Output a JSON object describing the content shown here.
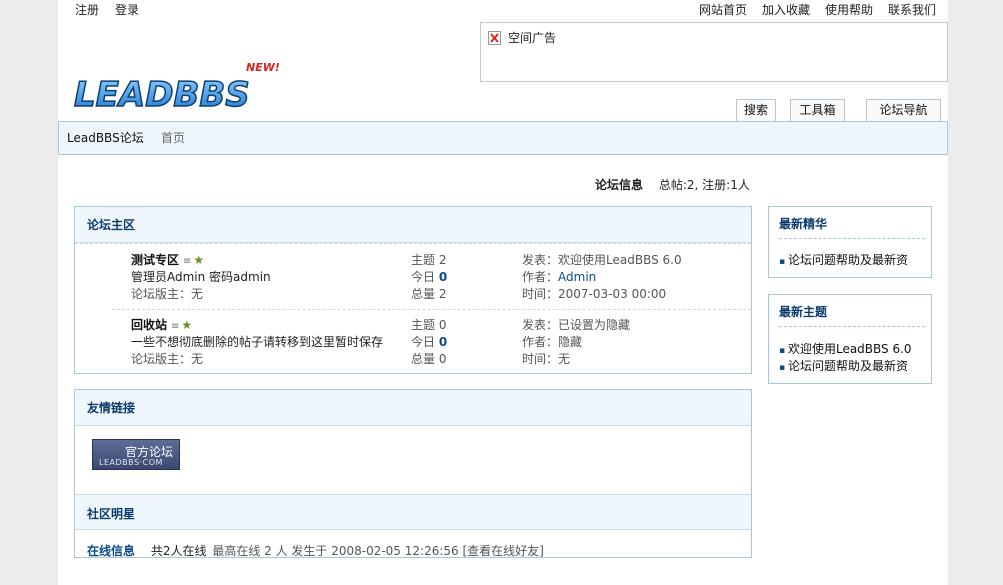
{
  "top_left": {
    "register": "注册",
    "login": "登录"
  },
  "top_right": [
    "网站首页",
    "加入收藏",
    "使用帮助",
    "联系我们"
  ],
  "ad": {
    "label": "空间广告"
  },
  "logo": {
    "text": "LEADBBS",
    "badge": "NEW!"
  },
  "tabs": [
    "搜索",
    "工具箱",
    "论坛导航"
  ],
  "breadcrumb": {
    "forum": "LeadBBS论坛",
    "home": "首页"
  },
  "forum_info": {
    "label": "论坛信息",
    "stats": "总帖:2, 注册:1人"
  },
  "main_section": {
    "title": "论坛主区",
    "forums": [
      {
        "name": "测试专区",
        "desc": "管理员Admin 密码admin",
        "moderator": "论坛版主：无",
        "topics_label": "主题",
        "topics": "2",
        "today_label": "今日",
        "today": "0",
        "total_label": "总量",
        "total": "2",
        "post_label": "发表：",
        "post": "欢迎使用LeadBBS 6.0",
        "author_label": "作者：",
        "author": "Admin",
        "time_label": "时间：",
        "time": "2007-03-03 00:00"
      },
      {
        "name": "回收站",
        "desc": "一些不想彻底删除的帖子请转移到这里暂时保存",
        "moderator": "论坛版主：无",
        "topics_label": "主题",
        "topics": "0",
        "today_label": "今日",
        "today": "0",
        "total_label": "总量",
        "total": "0",
        "post_label": "发表：",
        "post": "已设置为隐藏",
        "author_label": "作者：",
        "author": "隐藏",
        "time_label": "时间：",
        "time": "无"
      }
    ]
  },
  "links_section": {
    "title": "友情链接",
    "badge_main": "官方论坛",
    "badge_sub": "LEADBBS·COM"
  },
  "stars_section": {
    "title": "社区明星"
  },
  "online": {
    "title": "在线信息",
    "prefix": "共2人在线",
    "max": "最高在线 2 人 发生于 2008-02-05 12:26:56",
    "link_open": "[",
    "link": "查看在线好友",
    "link_close": "]"
  },
  "sidebar": {
    "featured": {
      "title": "最新精华",
      "items": [
        "论坛问题帮助及最新资"
      ]
    },
    "latest": {
      "title": "最新主题",
      "items": [
        "欢迎使用LeadBBS 6.0",
        "论坛问题帮助及最新资"
      ]
    }
  },
  "colors": {
    "accent": "#0b3b6d",
    "panel_border": "#a9c7dc",
    "panel_head_bg": "#f0f7fc"
  }
}
